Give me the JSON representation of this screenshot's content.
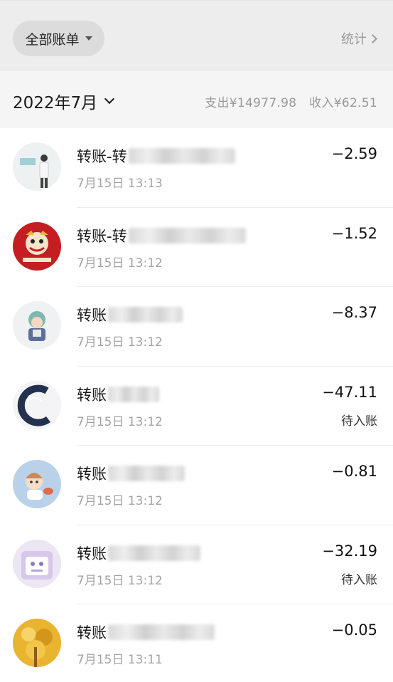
{
  "header": {
    "filter_label": "全部账单",
    "stats_label": "统计"
  },
  "month_bar": {
    "month": "2022年7月",
    "expense": "支出¥14977.98",
    "income": "收入¥62.51"
  },
  "transactions": [
    {
      "title": "转账-转",
      "time": "7月15日 13:13",
      "amount": "−2.59",
      "status": ""
    },
    {
      "title": "转账-转",
      "time": "7月15日 13:12",
      "amount": "−1.52",
      "status": ""
    },
    {
      "title": "转账",
      "time": "7月15日 13:12",
      "amount": "−8.37",
      "status": ""
    },
    {
      "title": "转账",
      "time": "7月15日 13:12",
      "amount": "−47.11",
      "status": "待入账"
    },
    {
      "title": "转账",
      "time": "7月15日 13:12",
      "amount": "−0.81",
      "status": ""
    },
    {
      "title": "转账",
      "time": "7月15日 13:12",
      "amount": "−32.19",
      "status": "待入账"
    },
    {
      "title": "转账",
      "time": "7月15日 13:11",
      "amount": "−0.05",
      "status": ""
    }
  ],
  "colors": {
    "header_bg": "#ededed",
    "month_bar_bg": "#f5f5f5",
    "muted_text": "#9a9a9a"
  }
}
